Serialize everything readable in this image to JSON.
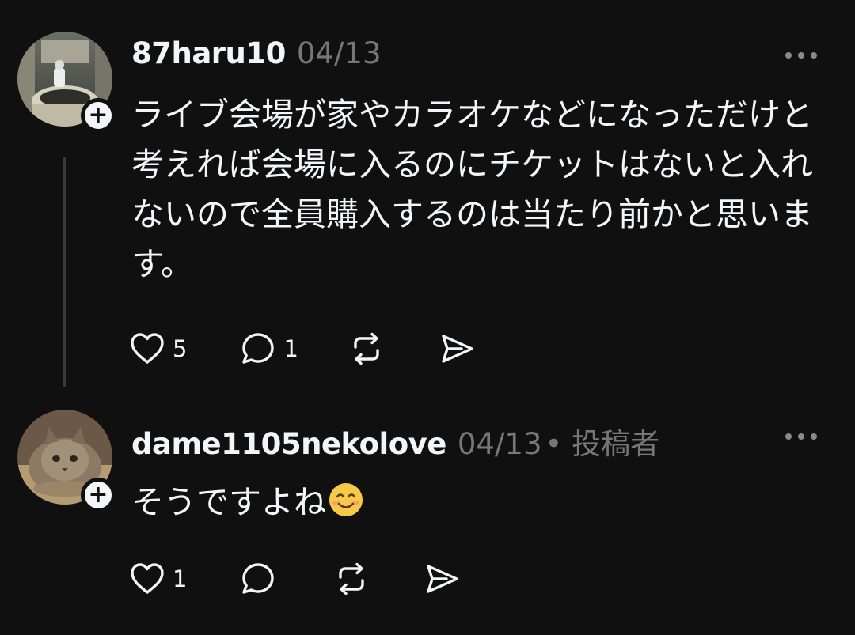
{
  "posts": [
    {
      "username": "87haru10",
      "date": "04/13",
      "role": "",
      "text": "ライブ会場が家やカラオケなどになっただけと考えれば会場に入るのにチケットはないと入れないので全員購入するのは当たり前かと思います。",
      "likes": "5",
      "replies": "1",
      "avatar_icon": "avatar-photo-fountain"
    },
    {
      "username": "dame1105nekolove",
      "date": "04/13",
      "role": "• 投稿者",
      "text": "そうですよね",
      "emoji": "smiling-face-emoji",
      "likes": "1",
      "replies": "",
      "avatar_icon": "avatar-photo-cat"
    }
  ],
  "icons": {
    "more": "more-icon",
    "plus": "+",
    "like": "heart-icon",
    "reply": "comment-icon",
    "repost": "repost-icon",
    "share": "send-icon"
  },
  "colors": {
    "background": "#101010",
    "text": "#f3f5f7",
    "muted": "#777777",
    "thread_line": "#3a3a3a"
  }
}
